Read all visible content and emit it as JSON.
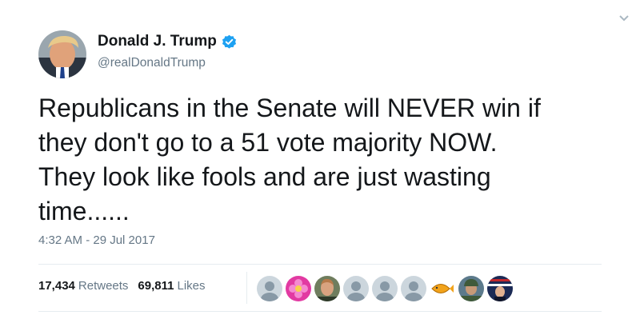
{
  "user": {
    "display_name": "Donald J. Trump",
    "handle": "@realDonaldTrump",
    "verified": true
  },
  "tweet": {
    "text": "Republicans in the Senate will NEVER win if\nthey don't go to a 51 vote majority NOW.\nThey look like fools and are just wasting\ntime......",
    "timestamp": "4:32 AM - 29 Jul 2017"
  },
  "stats": {
    "retweets_count": "17,434",
    "retweets_label": "Retweets",
    "likes_count": "69,811",
    "likes_label": "Likes"
  },
  "likers": [
    {
      "kind": "default-avatar-icon"
    },
    {
      "kind": "pink-flower-avatar"
    },
    {
      "kind": "man-photo-avatar"
    },
    {
      "kind": "default-avatar-icon"
    },
    {
      "kind": "default-avatar-icon"
    },
    {
      "kind": "default-avatar-icon"
    },
    {
      "kind": "ichthys-logo-avatar"
    },
    {
      "kind": "soldier-avatar"
    },
    {
      "kind": "flag-portrait-avatar"
    }
  ],
  "colors": {
    "text": "#14171a",
    "secondary": "#657786",
    "verified_blue": "#1da1f2",
    "divider": "#e6ecf0"
  }
}
